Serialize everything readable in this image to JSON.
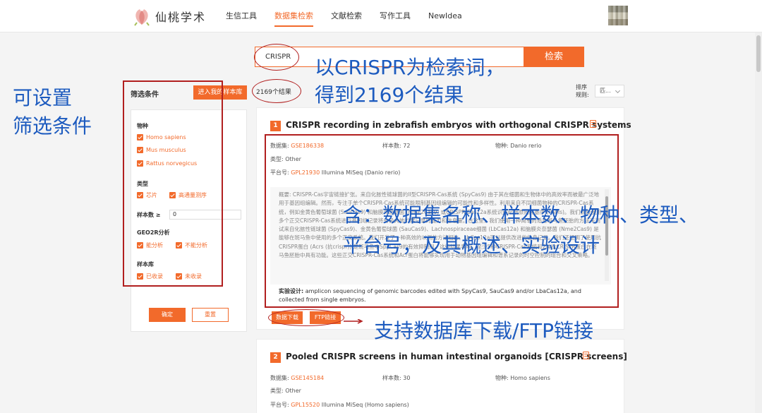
{
  "header": {
    "logo_text": "仙桃学术",
    "nav": [
      "生信工具",
      "数据集检索",
      "文献检索",
      "写作工具",
      "NewIdea"
    ],
    "active_nav_index": 1
  },
  "search": {
    "query": "CRISPR",
    "button_label": "检索"
  },
  "filter": {
    "title": "筛选条件",
    "my_lib_button": "进入我的样本库",
    "species_title": "物种",
    "species": [
      "Homo sapiens",
      "Mus musculus",
      "Rattus norvegicus"
    ],
    "type_title": "类型",
    "types": [
      "芯片",
      "高通量测序"
    ],
    "sample_count_label": "样本数 ≥",
    "sample_count_value": "0",
    "geo2r_title": "GEO2R分析",
    "geo2r": [
      "能分析",
      "不能分析"
    ],
    "library_title": "样本库",
    "library": [
      "已收录",
      "未收录"
    ],
    "confirm_label": "确定",
    "reset_label": "重置"
  },
  "results": {
    "count_text": "2169个结果",
    "sort_label": "排序规则:",
    "sort_value": "匹..."
  },
  "cards": [
    {
      "index": "1",
      "title": "CRISPR recording in zebrafish embryos with orthogonal CRISPR systems",
      "dataset_label": "数据集:",
      "dataset_id": "GSE186338",
      "samples_label": "样本数:",
      "samples_value": "72",
      "species_label": "物种:",
      "species_value": "Danio rerio",
      "type_label": "类型:",
      "type_value": "Other",
      "platform_label": "平台号:",
      "platform_id": "GPL21930",
      "platform_desc": "Illumina MiSeq (Danio rerio)",
      "summary": "概要: CRISPR-Cas宇宙链接扩张。来自化脓性链球菌的II型CRISPR-Cas系统 (SpyCas9) 由于其在细菌和生物体中的高效率而被最广泛地用于基因组编辑。然而，专注于单个CRISPR-Cas系统可能限制基因组编辑的可能性和多样性。利用来自不同细菌物种的CRISPR-Cas系统，例如金黄色葡萄球菌 (SauCas9) 和脑膜炎奈瑟菌 (Nme2Cas9) 或CRISPR-Cas12a系统识别起始原间隔基序 (PAMs)。我们假设使用多个正交CRISPR-Cas系统进行基因组记录将会极大地扩展记录的能力和信息量。在这里，我们使用一种简单的适合斑马鱼胚胎的方法来测试来自化脓性链球菌 (SpyCas9)、金黄色葡萄球菌 (SauCas9)、Lachnospiraceae细菌 (LbCas12a) 和脑膜炎奈瑟菌 (Nme2Cas9) 是能够在斑马鱼中使用的多个正交系统。我们开发了一种高效的以测的方法相比，LbCas12a可以提供改进的信息记录。我们还证明了使用抗CRISPR蛋白 (Acrs (抗crispr)) 是斑马鱼中SpyCas9的有效抑制剂。这些结果表明，至少5种CRISPR-Cas系统和2种抗CRISPR蛋白在斑马鱼胚胎中具有功能。这些正交CRISPR-Cas系统和Acr蛋白将能够实现用于动物基因组编辑和谱系记录的时空控制的组合和交叉策略。",
      "design_label": "实验设计:",
      "design_text": "amplicon sequencing of genomic barcodes edited with SpyCas9, SauCas9 and/or LbaCas12a, and collected from single embryos.",
      "download_label": "数据下载",
      "ftp_label": "FTP链接"
    },
    {
      "index": "2",
      "title": "Pooled CRISPR screens in human intestinal organoids [CRISPR screens]",
      "dataset_label": "数据集:",
      "dataset_id": "GSE145184",
      "samples_label": "样本数:",
      "samples_value": "30",
      "species_label": "物种:",
      "species_value": "Homo sapiens",
      "type_label": "类型:",
      "type_value": "Other",
      "platform_label": "平台号:",
      "platform_id": "GPL15520",
      "platform_desc": "Illumina MiSeq (Homo sapiens)"
    }
  ],
  "annotations": {
    "search_note_line1": "以CRISPR为检索词，",
    "search_note_line2": "得到2169个结果",
    "filter_note_line1": "可设置",
    "filter_note_line2": "筛选条件",
    "card_note_line1": "含：数据集名称、样本数、物种、类型、",
    "card_note_line2": "平台号，及其概述、实验设计",
    "download_note": "支持数据库下载/FTP链接"
  },
  "colors": {
    "accent": "#f26a2b",
    "annotation_red": "#b11f1f",
    "annotation_blue": "#1d5bbf"
  }
}
